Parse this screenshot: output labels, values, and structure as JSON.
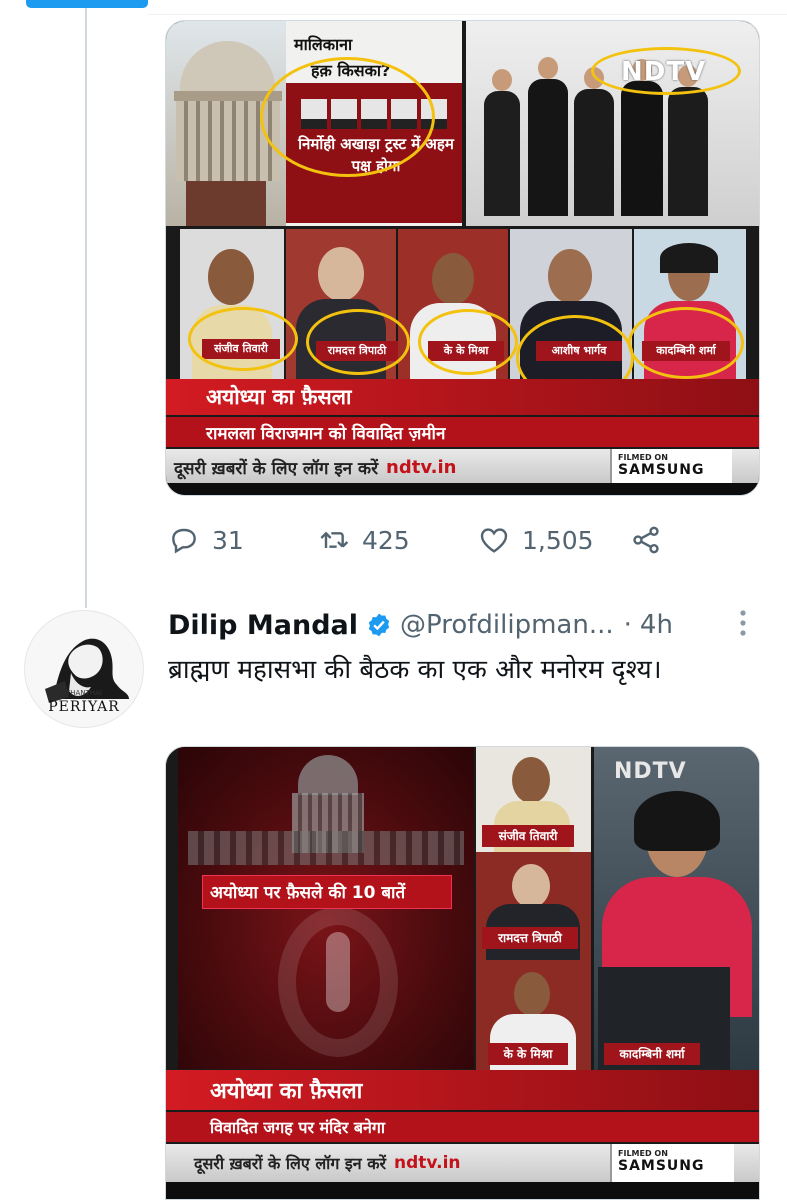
{
  "previous_tweet": {
    "image": {
      "question_line1": "मालिकाना",
      "question_line2": "हक़ किसका?",
      "red_box_text": "निर्मोही अखाड़ा ट्रस्ट में अहम पक्ष होगा",
      "channel_logo": "NDTV",
      "panelists": [
        "संजीव तिवारी",
        "रामदत्त त्रिपाठी",
        "के के मिश्रा",
        "आशीष भार्गव",
        "कादम्बिनी शर्मा"
      ],
      "show_title": "अयोध्या का फ़ैसला",
      "subtitle": "रामलला विराजमान को विवादित ज़मीन",
      "ticker": "दूसरी ख़बरों के लिए लॉग इन करें",
      "ticker_url": "ndtv.in",
      "filmed_on": "FILMED ON",
      "sponsor": "SAMSUNG"
    },
    "actions": {
      "replies": "31",
      "retweets": "425",
      "likes": "1,505"
    }
  },
  "tweet": {
    "author_name": "Dilip Mandal",
    "handle": "@Profdilipman...",
    "separator": "·",
    "time": "4h",
    "text": "ब्राह्मण महासभा की बैठक का एक और मनोरम दृश्य।",
    "avatar_caption": "PERIYAR",
    "avatar_small": "THANTHAI",
    "image": {
      "headline": "अयोध्या पर फ़ैसले की 10 बातें",
      "channel_logo": "NDTV",
      "panelists": [
        "संजीव तिवारी",
        "रामदत्त त्रिपाठी",
        "के के मिश्रा"
      ],
      "anchor": "कादम्बिनी शर्मा",
      "show_title": "अयोध्या का फ़ैसला",
      "subtitle": "विवादित जगह पर मंदिर बनेगा",
      "ticker": "दूसरी ख़बरों के लिए लॉग इन करें",
      "ticker_url": "ndtv.in",
      "filmed_on": "FILMED ON",
      "sponsor": "SAMSUNG"
    }
  },
  "colors": {
    "accent": "#1d9bf0",
    "secondary_text": "#536471",
    "annotation_yellow": "#f3c20f",
    "news_red": "#b3121a"
  },
  "icons": [
    "reply-icon",
    "retweet-icon",
    "like-icon",
    "share-icon",
    "verified-badge-icon",
    "more-options-icon"
  ]
}
